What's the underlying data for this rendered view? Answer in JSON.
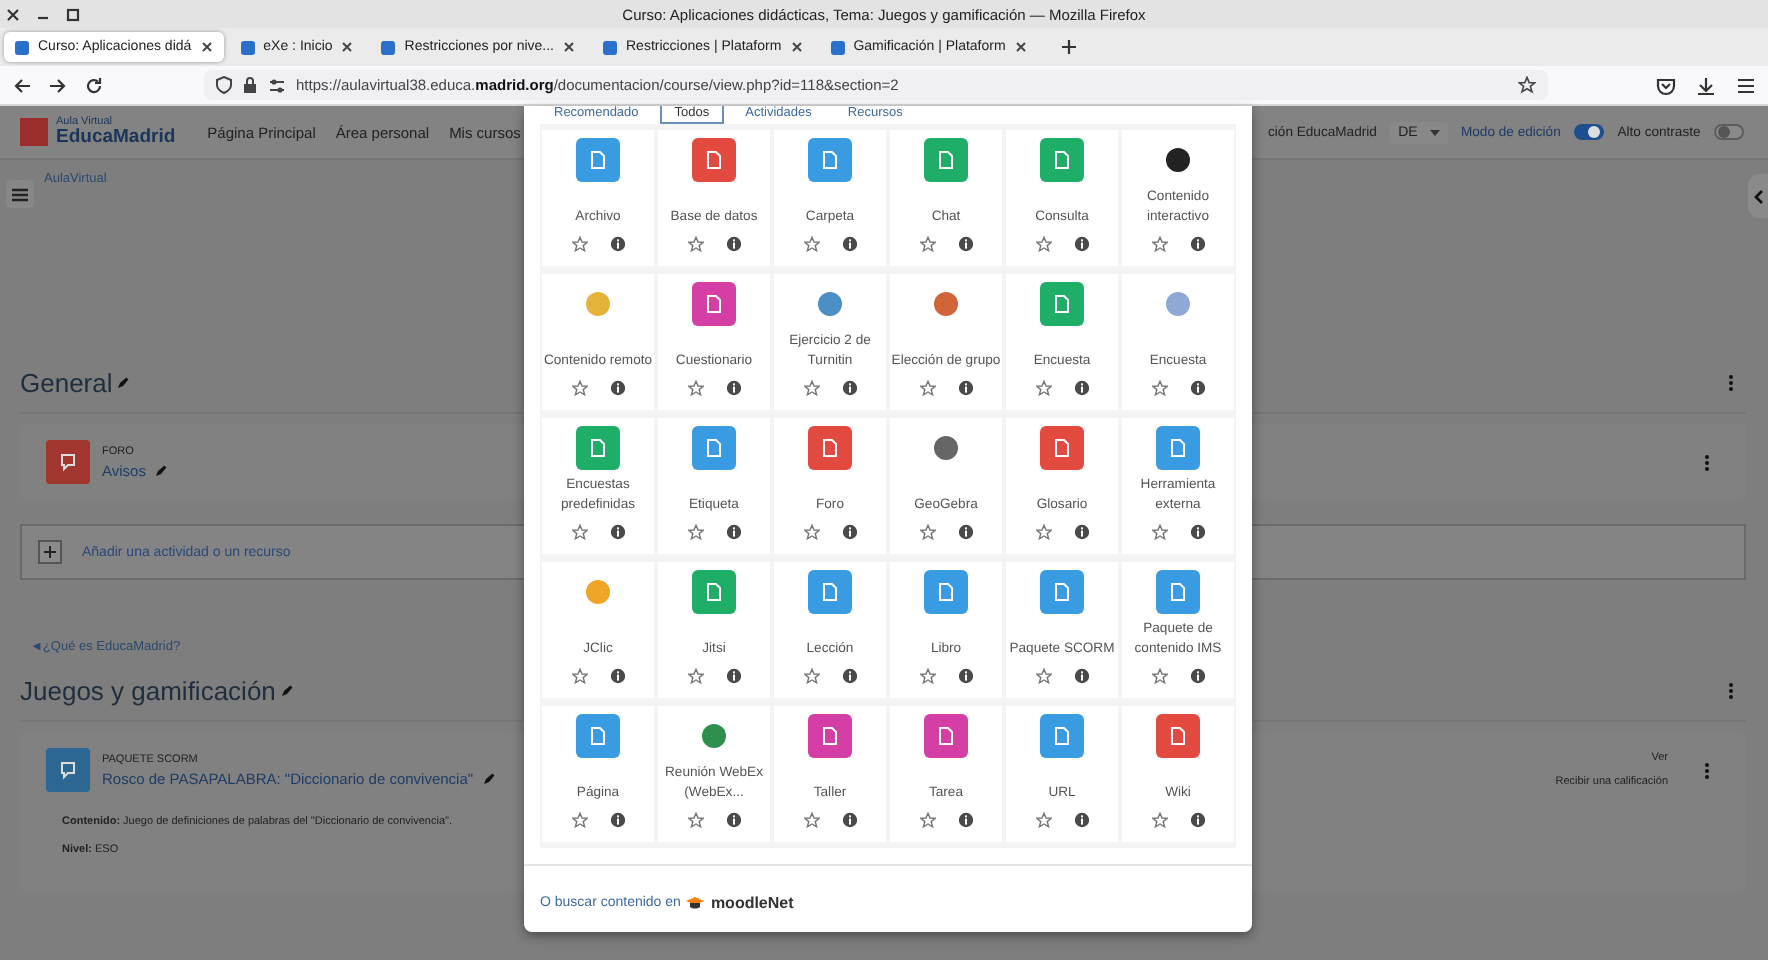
{
  "window": {
    "title": "Curso: Aplicaciones didácticas, Tema: Juegos y gamificación — Mozilla Firefox"
  },
  "tabs": [
    {
      "label": "Curso: Aplicaciones didá",
      "selected": true
    },
    {
      "label": "eXe : Inicio",
      "selected": false
    },
    {
      "label": "Restricciones por nive...",
      "selected": false
    },
    {
      "label": "Restricciones | Plataform",
      "selected": false
    },
    {
      "label": "Gamificación | Plataform",
      "selected": false
    }
  ],
  "address_bar": {
    "url": "https://aulavirtual38.educa.**madrid.org**/documentacion/course/view.php?id=118&section=2"
  },
  "site_header": {
    "logo_small": "Aula Virtual",
    "logo_large": "EducaMadrid",
    "nav": [
      "Página Principal",
      "Área personal",
      "Mis cursos"
    ],
    "nav_cut": "ción EducaMadrid",
    "language": "DE",
    "edit_mode": {
      "label": "Modo de edición",
      "on": true
    },
    "high_contrast": {
      "label": "Alto contraste",
      "on": false
    }
  },
  "breadcrumb": "AulaVirtual",
  "sections": [
    {
      "title": "General",
      "activities": [
        {
          "type": "FORO",
          "name": "Avisos",
          "color": "#a1362f"
        }
      ],
      "add_label": "Añadir una actividad o un recurso",
      "footer_link": "◄¿Qué es EducaMadrid?"
    },
    {
      "title": "Juegos y gamificación",
      "activities": [
        {
          "type": "PAQUETE SCORM",
          "name": "Rosco de PASAPALABRA: \"Diccionario de convivencia\"",
          "color": "#2d6894",
          "status": "Ver",
          "completion": "Recibir una calificación",
          "description": "**Contenido:** Juego de definiciones de palabras del \"Diccionario de convivencia\".",
          "level_text": "**Nivel:** ESO"
        }
      ]
    }
  ],
  "chooser": {
    "tabs": [
      {
        "label": "Recomendado",
        "selected": false
      },
      {
        "label": "Todos",
        "selected": true
      },
      {
        "label": "Actividades",
        "selected": false
      },
      {
        "label": "Recursos",
        "selected": false
      }
    ],
    "items": [
      {
        "name": "Archivo",
        "kind": "tile",
        "color": "#399be2",
        "starred": false
      },
      {
        "name": "Base de datos",
        "kind": "tile",
        "color": "#e34a3f",
        "starred": false
      },
      {
        "name": "Carpeta",
        "kind": "tile",
        "color": "#399be2",
        "starred": false
      },
      {
        "name": "Chat",
        "kind": "tile",
        "color": "#1fae68",
        "starred": false
      },
      {
        "name": "Consulta",
        "kind": "tile",
        "color": "#1fae68",
        "starred": false
      },
      {
        "name": "Contenido interactivo",
        "kind": "image",
        "color": "#222222",
        "starred": false
      },
      {
        "name": "Contenido remoto",
        "kind": "image",
        "color": "#e6b33a",
        "starred": false
      },
      {
        "name": "Cuestionario",
        "kind": "tile",
        "color": "#d53fa5",
        "starred": false
      },
      {
        "name": "Ejercicio 2 de Turnitin",
        "kind": "image",
        "color": "#4a8fc7",
        "starred": false
      },
      {
        "name": "Elección de grupo",
        "kind": "image",
        "color": "#d2643a",
        "starred": false
      },
      {
        "name": "Encuesta",
        "kind": "tile",
        "color": "#1fae68",
        "starred": false
      },
      {
        "name": "Encuesta",
        "kind": "image",
        "color": "#8fa9d6",
        "starred": false
      },
      {
        "name": "Encuestas predefinidas",
        "kind": "tile",
        "color": "#1fae68",
        "starred": false
      },
      {
        "name": "Etiqueta",
        "kind": "tile",
        "color": "#399be2",
        "starred": false
      },
      {
        "name": "Foro",
        "kind": "tile",
        "color": "#e34a3f",
        "starred": false
      },
      {
        "name": "GeoGebra",
        "kind": "image",
        "color": "#666666",
        "starred": false
      },
      {
        "name": "Glosario",
        "kind": "tile",
        "color": "#e34a3f",
        "starred": false
      },
      {
        "name": "Herramienta externa",
        "kind": "tile",
        "color": "#399be2",
        "starred": false
      },
      {
        "name": "JClic",
        "kind": "image",
        "color": "#f0a526",
        "starred": false
      },
      {
        "name": "Jitsi",
        "kind": "tile",
        "color": "#1fae68",
        "starred": false
      },
      {
        "name": "Lección",
        "kind": "tile",
        "color": "#399be2",
        "starred": false
      },
      {
        "name": "Libro",
        "kind": "tile",
        "color": "#399be2",
        "starred": false
      },
      {
        "name": "Paquete SCORM",
        "kind": "tile",
        "color": "#399be2",
        "starred": false
      },
      {
        "name": "Paquete de contenido IMS",
        "kind": "tile",
        "color": "#399be2",
        "starred": false
      },
      {
        "name": "Página",
        "kind": "tile",
        "color": "#399be2",
        "starred": false
      },
      {
        "name": "Reunión WebEx (WebEx...",
        "kind": "image",
        "color": "#2f8f4e",
        "starred": false
      },
      {
        "name": "Taller",
        "kind": "tile",
        "color": "#d53fa5",
        "starred": false
      },
      {
        "name": "Tarea",
        "kind": "tile",
        "color": "#d53fa5",
        "starred": false
      },
      {
        "name": "URL",
        "kind": "tile",
        "color": "#399be2",
        "starred": false
      },
      {
        "name": "Wiki",
        "kind": "tile",
        "color": "#e34a3f",
        "starred": false
      }
    ],
    "footer_text": "O buscar contenido en",
    "footer_logo": "moodleNet"
  }
}
